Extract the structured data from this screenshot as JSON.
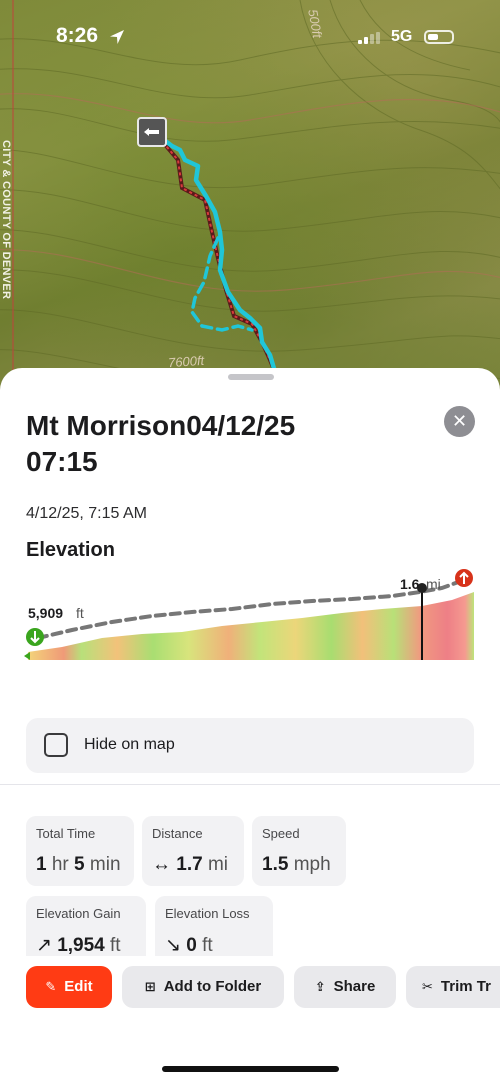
{
  "status_bar": {
    "time": "8:26",
    "network": "5G"
  },
  "map": {
    "county_label": "CITY & COUNTY OF DENVER",
    "contour_labels": [
      "7600ft",
      "500ft"
    ],
    "track_color": "#20c6d8"
  },
  "sheet": {
    "title": "Mt Morrison04/12/25 07:15",
    "date": "4/12/25, 7:15 AM",
    "elevation_heading": "Elevation",
    "start_elevation_value": "5,909",
    "start_elevation_unit": "ft",
    "cursor_distance_value": "1.6",
    "cursor_distance_unit": "mi",
    "hide_on_map_label": "Hide on map",
    "hide_on_map_checked": false
  },
  "stats": {
    "total_time": {
      "label": "Total Time",
      "hours": "1",
      "hours_unit": "hr",
      "minutes": "5",
      "minutes_unit": "min"
    },
    "distance": {
      "label": "Distance",
      "value": "1.7",
      "unit": "mi"
    },
    "speed": {
      "label": "Speed",
      "value": "1.5",
      "unit": "mph"
    },
    "elevation_gain": {
      "label": "Elevation Gain",
      "value": "1,954",
      "unit": "ft"
    },
    "elevation_loss": {
      "label": "Elevation Loss",
      "value": "0",
      "unit": "ft"
    }
  },
  "actions": {
    "edit": "Edit",
    "add_to_folder": "Add to Folder",
    "share": "Share",
    "trim": "Trim Tr"
  },
  "colors": {
    "accent": "#ff3b14",
    "track": "#20c6d8"
  }
}
